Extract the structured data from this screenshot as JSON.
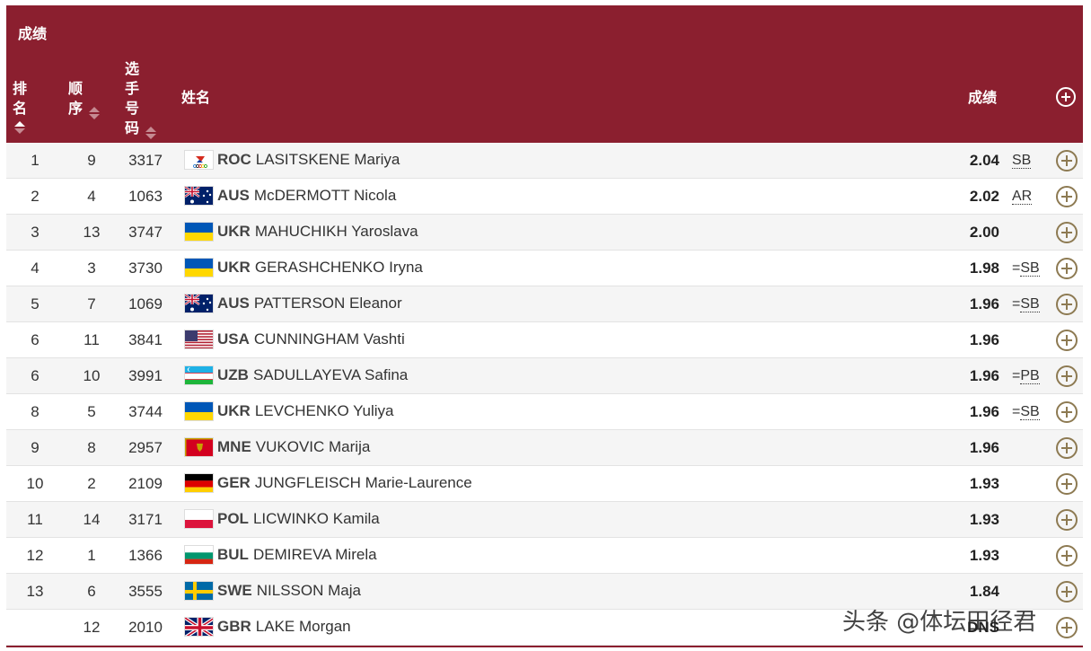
{
  "header": {
    "title": "成绩",
    "col_rank": "排名",
    "col_order": "顺序",
    "col_bib": "选手号码",
    "col_name": "姓名",
    "col_mark": "成绩"
  },
  "colors": {
    "header_bg": "#8b1f2f",
    "plus_icon": "#8d7a52"
  },
  "rows": [
    {
      "rank": "1",
      "order": "9",
      "bib": "3317",
      "nat": "ROC",
      "name": "LASITSKENE Mariya",
      "mark": "2.04",
      "prefix": "",
      "note": "SB",
      "flag": "roc"
    },
    {
      "rank": "2",
      "order": "4",
      "bib": "1063",
      "nat": "AUS",
      "name": "McDERMOTT Nicola",
      "mark": "2.02",
      "prefix": "",
      "note": "AR",
      "flag": "aus"
    },
    {
      "rank": "3",
      "order": "13",
      "bib": "3747",
      "nat": "UKR",
      "name": "MAHUCHIKH Yaroslava",
      "mark": "2.00",
      "prefix": "",
      "note": "",
      "flag": "ukr"
    },
    {
      "rank": "4",
      "order": "3",
      "bib": "3730",
      "nat": "UKR",
      "name": "GERASHCHENKO Iryna",
      "mark": "1.98",
      "prefix": "=",
      "note": "SB",
      "flag": "ukr"
    },
    {
      "rank": "5",
      "order": "7",
      "bib": "1069",
      "nat": "AUS",
      "name": "PATTERSON Eleanor",
      "mark": "1.96",
      "prefix": "=",
      "note": "SB",
      "flag": "aus"
    },
    {
      "rank": "6",
      "order": "11",
      "bib": "3841",
      "nat": "USA",
      "name": "CUNNINGHAM Vashti",
      "mark": "1.96",
      "prefix": "",
      "note": "",
      "flag": "usa"
    },
    {
      "rank": "6",
      "order": "10",
      "bib": "3991",
      "nat": "UZB",
      "name": "SADULLAYEVA Safina",
      "mark": "1.96",
      "prefix": "=",
      "note": "PB",
      "flag": "uzb"
    },
    {
      "rank": "8",
      "order": "5",
      "bib": "3744",
      "nat": "UKR",
      "name": "LEVCHENKO Yuliya",
      "mark": "1.96",
      "prefix": "=",
      "note": "SB",
      "flag": "ukr"
    },
    {
      "rank": "9",
      "order": "8",
      "bib": "2957",
      "nat": "MNE",
      "name": "VUKOVIC Marija",
      "mark": "1.96",
      "prefix": "",
      "note": "",
      "flag": "mne"
    },
    {
      "rank": "10",
      "order": "2",
      "bib": "2109",
      "nat": "GER",
      "name": "JUNGFLEISCH Marie-Laurence",
      "mark": "1.93",
      "prefix": "",
      "note": "",
      "flag": "ger"
    },
    {
      "rank": "11",
      "order": "14",
      "bib": "3171",
      "nat": "POL",
      "name": "LICWINKO Kamila",
      "mark": "1.93",
      "prefix": "",
      "note": "",
      "flag": "pol"
    },
    {
      "rank": "12",
      "order": "1",
      "bib": "1366",
      "nat": "BUL",
      "name": "DEMIREVA Mirela",
      "mark": "1.93",
      "prefix": "",
      "note": "",
      "flag": "bul"
    },
    {
      "rank": "13",
      "order": "6",
      "bib": "3555",
      "nat": "SWE",
      "name": "NILSSON Maja",
      "mark": "1.84",
      "prefix": "",
      "note": "",
      "flag": "swe"
    },
    {
      "rank": "",
      "order": "12",
      "bib": "2010",
      "nat": "GBR",
      "name": "LAKE Morgan",
      "mark": "DNS",
      "prefix": "",
      "note": "",
      "flag": "gbr"
    }
  ],
  "watermark": "头条 @体坛田径君"
}
